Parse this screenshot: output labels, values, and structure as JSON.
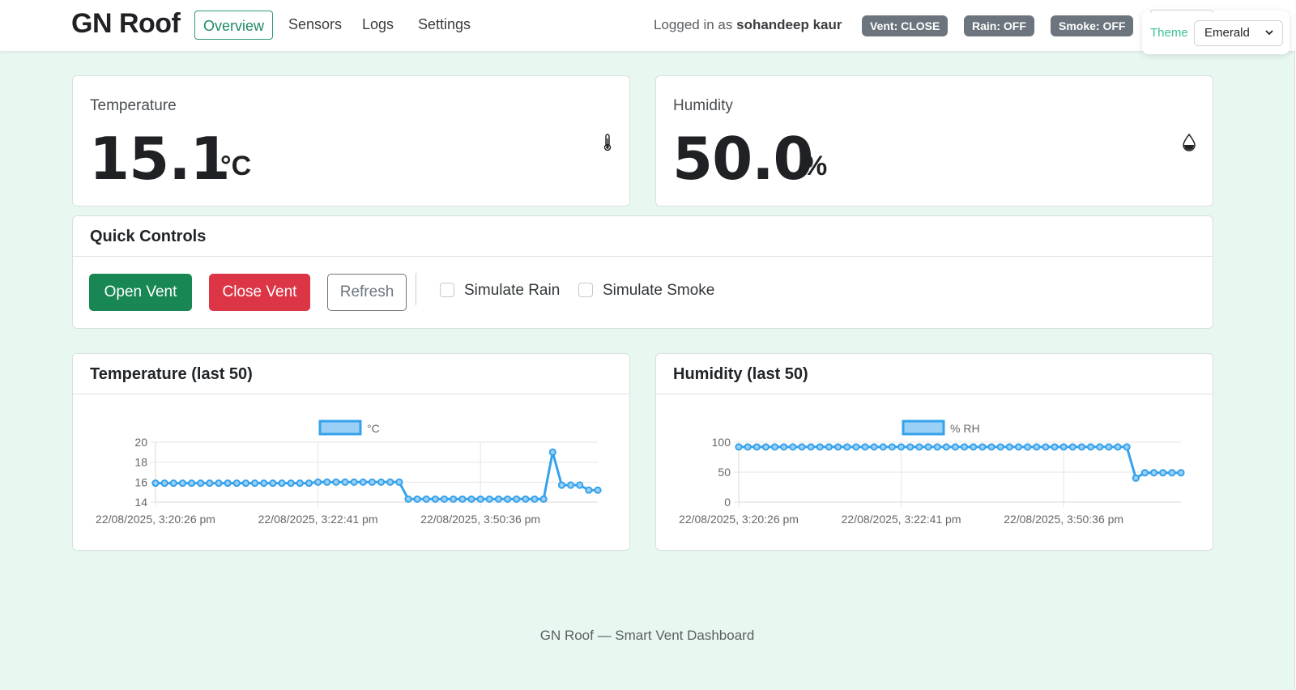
{
  "nav": {
    "brand": "GN Roof",
    "links": [
      "Overview",
      "Sensors",
      "Logs",
      "Settings"
    ],
    "active": "Overview",
    "logged_prefix": "Logged in as",
    "user": "sohandeep kaur",
    "badges": [
      "Vent: CLOSE",
      "Rain: OFF",
      "Smoke: OFF"
    ],
    "theme_label": "Theme",
    "theme_value": "Emerald"
  },
  "stats": {
    "temperature": {
      "label": "Temperature",
      "value": "15.1",
      "unit": "°C",
      "icon": "thermometer-icon"
    },
    "humidity": {
      "label": "Humidity",
      "value": "50.0",
      "unit": "%",
      "icon": "droplet-icon"
    }
  },
  "controls": {
    "title": "Quick Controls",
    "open_vent": "Open Vent",
    "close_vent": "Close Vent",
    "refresh": "Refresh",
    "simulate_rain": "Simulate Rain",
    "simulate_smoke": "Simulate Smoke"
  },
  "colors": {
    "accent": "#198754",
    "danger": "#dc3545",
    "line": "#36a2eb",
    "line_fill": "#9ad0f5",
    "page_bg": "#e8f8f1"
  },
  "chart_data": [
    {
      "type": "line",
      "title": "Temperature (last 50)",
      "legend": "top",
      "grid": true,
      "ylim": [
        14,
        20
      ],
      "yticks": [
        14,
        16,
        18,
        20
      ],
      "xtick_labels": [
        "22/08/2025, 3:20:26 pm",
        "22/08/2025, 3:22:41 pm",
        "22/08/2025, 3:50:36 pm"
      ],
      "series": [
        {
          "name": "°C",
          "values": [
            15.9,
            15.9,
            15.9,
            15.9,
            15.9,
            15.9,
            15.9,
            15.9,
            15.9,
            15.9,
            15.9,
            15.9,
            15.9,
            15.9,
            15.9,
            15.9,
            15.9,
            15.9,
            16.0,
            16.0,
            16.0,
            16.0,
            16.0,
            16.0,
            16.0,
            16.0,
            16.0,
            16.0,
            14.3,
            14.3,
            14.3,
            14.3,
            14.3,
            14.3,
            14.3,
            14.3,
            14.3,
            14.3,
            14.3,
            14.3,
            14.3,
            14.3,
            14.3,
            14.3,
            19.0,
            15.7,
            15.7,
            15.7,
            15.2,
            15.2
          ]
        }
      ]
    },
    {
      "type": "line",
      "title": "Humidity (last 50)",
      "legend": "top",
      "grid": true,
      "ylim": [
        0,
        100
      ],
      "yticks": [
        0,
        50,
        100
      ],
      "xtick_labels": [
        "22/08/2025, 3:20:26 pm",
        "22/08/2025, 3:22:41 pm",
        "22/08/2025, 3:50:36 pm"
      ],
      "series": [
        {
          "name": "% RH",
          "values": [
            92,
            92,
            92,
            92,
            92,
            92,
            92,
            92,
            92,
            92,
            92,
            92,
            92,
            92,
            92,
            92,
            92,
            92,
            92,
            92,
            92,
            92,
            92,
            92,
            92,
            92,
            92,
            92,
            92,
            92,
            92,
            92,
            92,
            92,
            92,
            92,
            92,
            92,
            92,
            92,
            92,
            92,
            92,
            92,
            40,
            49,
            49,
            49,
            49,
            49
          ]
        }
      ]
    }
  ],
  "footer": "GN Roof — Smart Vent Dashboard"
}
